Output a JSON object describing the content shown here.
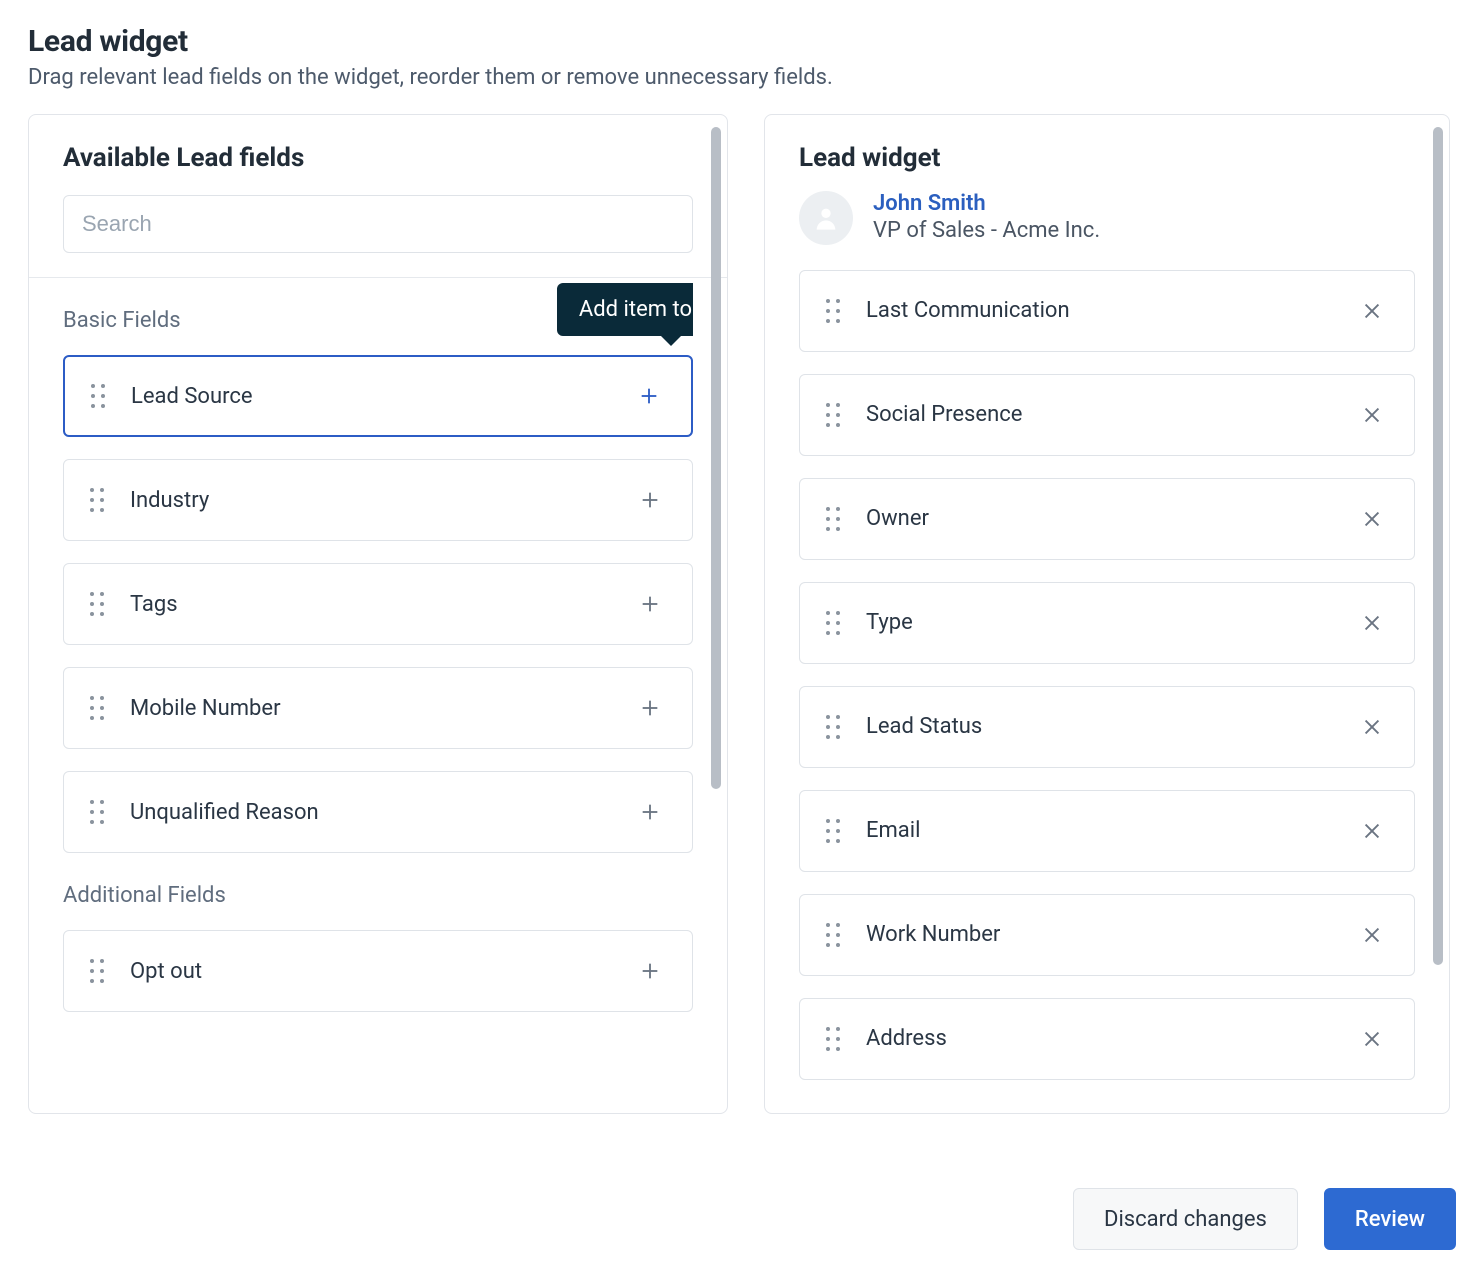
{
  "header": {
    "title": "Lead widget",
    "subtitle": "Drag relevant lead fields on the widget, reorder them or remove unnecessary fields."
  },
  "available": {
    "title": "Available Lead fields",
    "search_placeholder": "Search",
    "groups": [
      {
        "label": "Basic Fields",
        "items": [
          {
            "label": "Lead Source",
            "selected": true
          },
          {
            "label": "Industry"
          },
          {
            "label": "Tags"
          },
          {
            "label": "Mobile Number"
          },
          {
            "label": "Unqualified Reason"
          }
        ]
      },
      {
        "label": "Additional Fields",
        "items": [
          {
            "label": "Opt out"
          }
        ]
      }
    ],
    "tooltip": "Add item to widget"
  },
  "widget": {
    "title": "Lead widget",
    "person": {
      "name": "John Smith",
      "subtitle": "VP of Sales - Acme Inc."
    },
    "items": [
      {
        "label": "Last Communication"
      },
      {
        "label": "Social Presence"
      },
      {
        "label": "Owner"
      },
      {
        "label": "Type"
      },
      {
        "label": "Lead Status"
      },
      {
        "label": "Email"
      },
      {
        "label": "Work Number"
      },
      {
        "label": "Address"
      }
    ]
  },
  "footer": {
    "discard": "Discard changes",
    "review": "Review"
  }
}
